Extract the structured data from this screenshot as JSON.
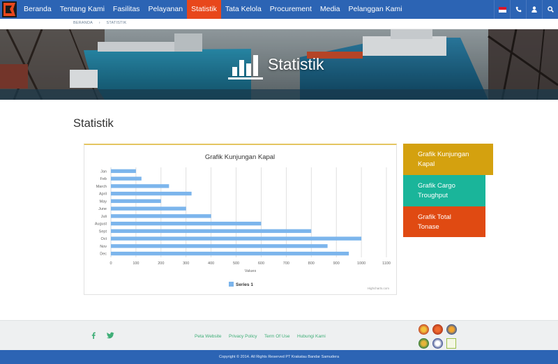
{
  "nav": {
    "items": [
      {
        "label": "Beranda"
      },
      {
        "label": "Tentang Kami"
      },
      {
        "label": "Fasilitas"
      },
      {
        "label": "Pelayanan"
      },
      {
        "label": "Statistik"
      },
      {
        "label": "Tata Kelola"
      },
      {
        "label": "Procurement"
      },
      {
        "label": "Media"
      },
      {
        "label": "Pelanggan Kami"
      }
    ],
    "active_label": "Statistik",
    "right_icons": [
      "indonesia-flag-icon",
      "phone-icon",
      "user-icon",
      "search-icon"
    ],
    "bar_color": "#2c64b4",
    "active_color": "#e8471b"
  },
  "breadcrumb": [
    "BERANDA",
    "STATISTIK"
  ],
  "hero": {
    "title": "Statistik"
  },
  "page_title": "Statistik",
  "tabs": [
    {
      "label": "Grafik Kunjungan Kapal",
      "color": "#d4a10f"
    },
    {
      "label": "Grafik Cargo Troughput",
      "color": "#1ab59a"
    },
    {
      "label": "Grafik Total Tonase",
      "color": "#e04a12"
    }
  ],
  "chart": {
    "credits": "Highcharts.com"
  },
  "chart_data": {
    "type": "bar",
    "title": "Grafik Kunjungan Kapal",
    "categories": [
      "Jan",
      "Feb",
      "March",
      "April",
      "May",
      "June",
      "Juli",
      "August",
      "Sept",
      "Oct",
      "Nov",
      "Dec"
    ],
    "series": [
      {
        "name": "Series 1",
        "values": [
          100,
          122,
          232,
          322,
          200,
          300,
          400,
          600,
          800,
          1000,
          865,
          950
        ],
        "color": "#7cb5ec"
      }
    ],
    "xlabel": "",
    "ylabel": "Values",
    "ylim": [
      0,
      1100
    ],
    "ticks": [
      0,
      100,
      200,
      300,
      400,
      500,
      600,
      700,
      800,
      900,
      1000,
      1100
    ],
    "grid": true,
    "legend": "bottom-center"
  },
  "footer": {
    "social": [
      "facebook-icon",
      "twitter-icon"
    ],
    "links": [
      "Peta Website",
      "Privacy Policy",
      "Term Of Use",
      "Hubungi Kami"
    ],
    "link_color": "#3fae77",
    "copyright": "Copyright © 2014. All Rights Reserved PT Krakatau Bandar Samudera"
  }
}
